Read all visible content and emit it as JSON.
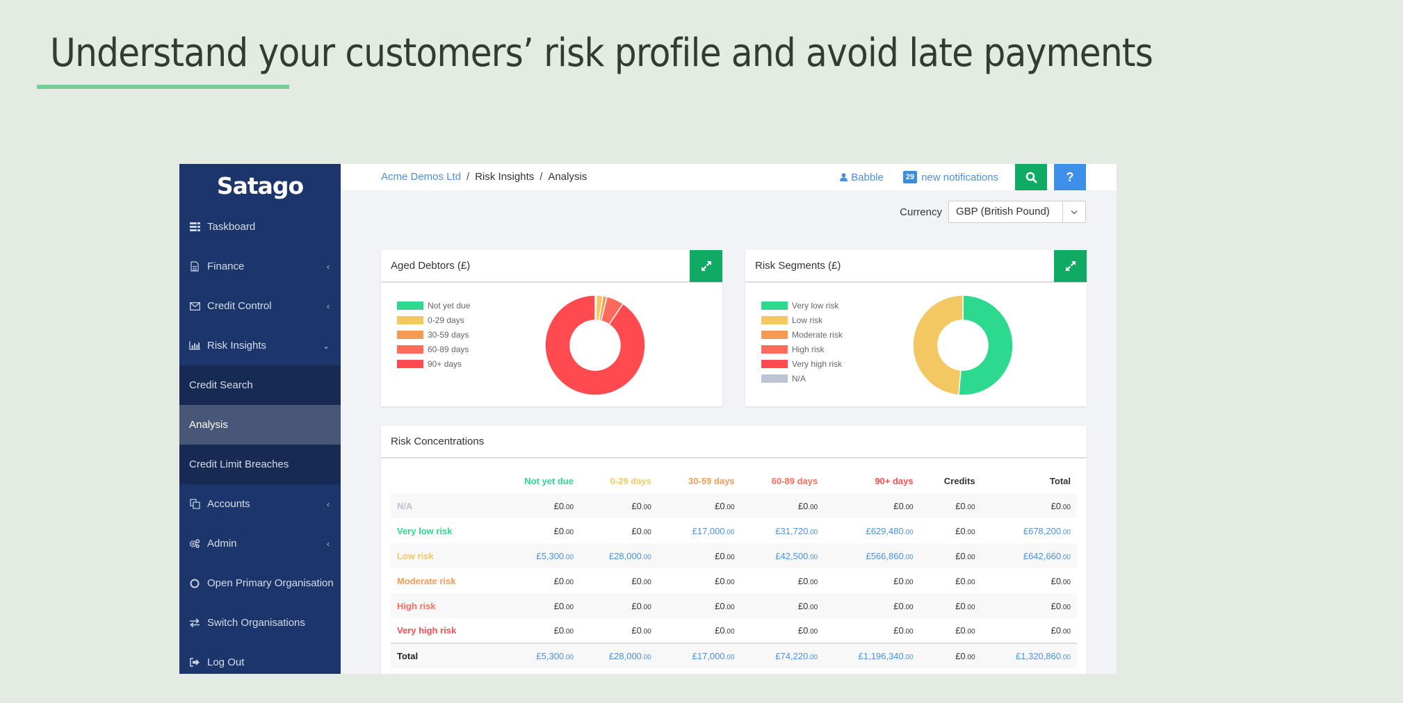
{
  "slide": {
    "title": "Understand your customers’ risk profile and avoid late payments"
  },
  "sidebar": {
    "logo": "Satago",
    "items": [
      {
        "label": "Taskboard",
        "icon": "taskboard-icon",
        "chevron": ""
      },
      {
        "label": "Finance",
        "icon": "document-icon",
        "chevron": "‹"
      },
      {
        "label": "Credit Control",
        "icon": "envelope-icon",
        "chevron": "‹"
      },
      {
        "label": "Risk Insights",
        "icon": "bar-chart-icon",
        "chevron": "⌄"
      }
    ],
    "sub_items": [
      {
        "label": "Credit Search",
        "active": false
      },
      {
        "label": "Analysis",
        "active": true
      },
      {
        "label": "Credit Limit Breaches",
        "active": false
      }
    ],
    "items_after": [
      {
        "label": "Accounts",
        "icon": "copy-icon",
        "chevron": "‹"
      },
      {
        "label": "Admin",
        "icon": "gears-icon",
        "chevron": "‹"
      },
      {
        "label": "Open Primary Organisation",
        "icon": "circle-icon",
        "chevron": ""
      },
      {
        "label": "Switch Organisations",
        "icon": "exchange-icon",
        "chevron": ""
      },
      {
        "label": "Log Out",
        "icon": "sign-out-icon",
        "chevron": ""
      }
    ]
  },
  "topbar": {
    "breadcrumb": [
      "Acme Demos Ltd",
      "Risk Insights",
      "Analysis"
    ],
    "separator": "/",
    "user": "Babble",
    "notifications_count": "29",
    "notifications_label": "new notifications",
    "help_label": "?"
  },
  "currency": {
    "label": "Currency",
    "value": "GBP (British Pound)"
  },
  "colors": {
    "not_yet_due": "#2dd88f",
    "d0_29": "#f3c862",
    "d30_59": "#f59a55",
    "d60_89": "#ff6b5b",
    "d90_plus": "#ff4b4f",
    "na": "#bcc3d2",
    "accent_green": "#0faa64",
    "accent_blue": "#3d8fe8",
    "sidebar": "#1c356a"
  },
  "chart_data": [
    {
      "type": "pie",
      "title": "Aged Debtors (£)",
      "donut": true,
      "legend": "left",
      "categories": [
        "Not yet due",
        "0-29 days",
        "30-59 days",
        "60-89 days",
        "90+ days"
      ],
      "values": [
        5300,
        28000,
        17000,
        74220,
        1196340
      ],
      "colors": [
        "#2dd88f",
        "#f3c862",
        "#f59a55",
        "#ff6b5b",
        "#ff4b4f"
      ]
    },
    {
      "type": "pie",
      "title": "Risk Segments (£)",
      "donut": true,
      "legend": "left",
      "categories": [
        "Very low risk",
        "Low risk",
        "Moderate risk",
        "High risk",
        "Very high risk",
        "N/A"
      ],
      "values": [
        678200,
        642660,
        0,
        0,
        0,
        0
      ],
      "colors": [
        "#2dd88f",
        "#f3c862",
        "#f59a55",
        "#ff6b5b",
        "#ff4b4f",
        "#bcc3d2"
      ]
    }
  ],
  "risk_table": {
    "title": "Risk Concentrations",
    "columns": [
      {
        "label": "",
        "color": "#333333"
      },
      {
        "label": "Not yet due",
        "color": "#2dd88f"
      },
      {
        "label": "0-29 days",
        "color": "#f3c862"
      },
      {
        "label": "30-59 days",
        "color": "#f59a55"
      },
      {
        "label": "60-89 days",
        "color": "#ff6b5b"
      },
      {
        "label": "90+ days",
        "color": "#ff4b4f"
      },
      {
        "label": "Credits",
        "color": "#333333"
      },
      {
        "label": "Total",
        "color": "#333333"
      }
    ],
    "rows": [
      {
        "label": "N/A",
        "color": "#bcc3d2",
        "values": [
          "£0",
          "£0",
          "£0",
          "£0",
          "£0",
          "£0",
          "£0"
        ]
      },
      {
        "label": "Very low risk",
        "color": "#2dd88f",
        "values": [
          "£0",
          "£0",
          "£17,000",
          "£31,720",
          "£629,480",
          "£0",
          "£678,200"
        ]
      },
      {
        "label": "Low risk",
        "color": "#f3c862",
        "values": [
          "£5,300",
          "£28,000",
          "£0",
          "£42,500",
          "£566,860",
          "£0",
          "£642,660"
        ]
      },
      {
        "label": "Moderate risk",
        "color": "#f59a55",
        "values": [
          "£0",
          "£0",
          "£0",
          "£0",
          "£0",
          "£0",
          "£0"
        ]
      },
      {
        "label": "High risk",
        "color": "#ff6b5b",
        "values": [
          "£0",
          "£0",
          "£0",
          "£0",
          "£0",
          "£0",
          "£0"
        ]
      },
      {
        "label": "Very high risk",
        "color": "#ff4b4f",
        "values": [
          "£0",
          "£0",
          "£0",
          "£0",
          "£0",
          "£0",
          "£0"
        ]
      }
    ],
    "total": {
      "label": "Total",
      "color": "#222222",
      "values": [
        "£5,300",
        "£28,000",
        "£17,000",
        "£74,220",
        "£1,196,340",
        "£0",
        "£1,320,860"
      ]
    },
    "decimals": ".00"
  }
}
